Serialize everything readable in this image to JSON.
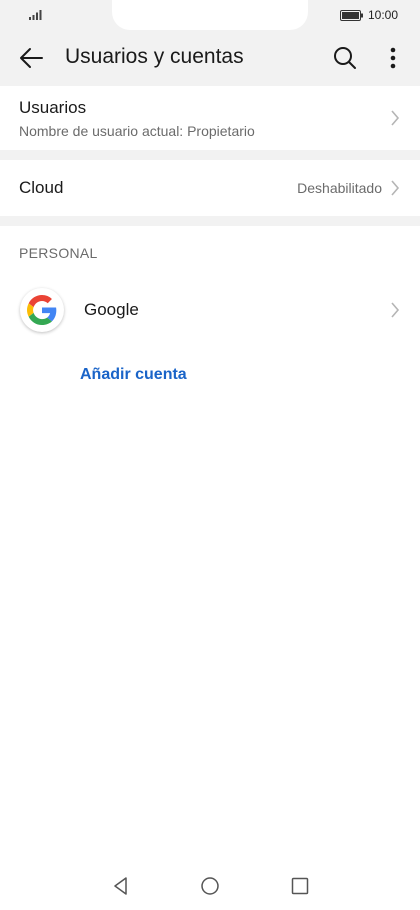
{
  "status": {
    "time": "10:00"
  },
  "toolbar": {
    "title": "Usuarios y cuentas",
    "back_icon": "arrow-left-icon",
    "search_icon": "search-icon",
    "more_icon": "more-vert-icon"
  },
  "users_row": {
    "title": "Usuarios",
    "subtitle": "Nombre de usuario actual: Propietario"
  },
  "cloud_row": {
    "title": "Cloud",
    "value": "Deshabilitado"
  },
  "personal": {
    "header": "PERSONAL",
    "accounts": [
      {
        "label": "Google",
        "icon": "google-icon"
      }
    ],
    "add_account_label": "Añadir cuenta"
  },
  "colors": {
    "accent": "#1a64c8",
    "background": "#f2f2f2",
    "card": "#ffffff"
  }
}
